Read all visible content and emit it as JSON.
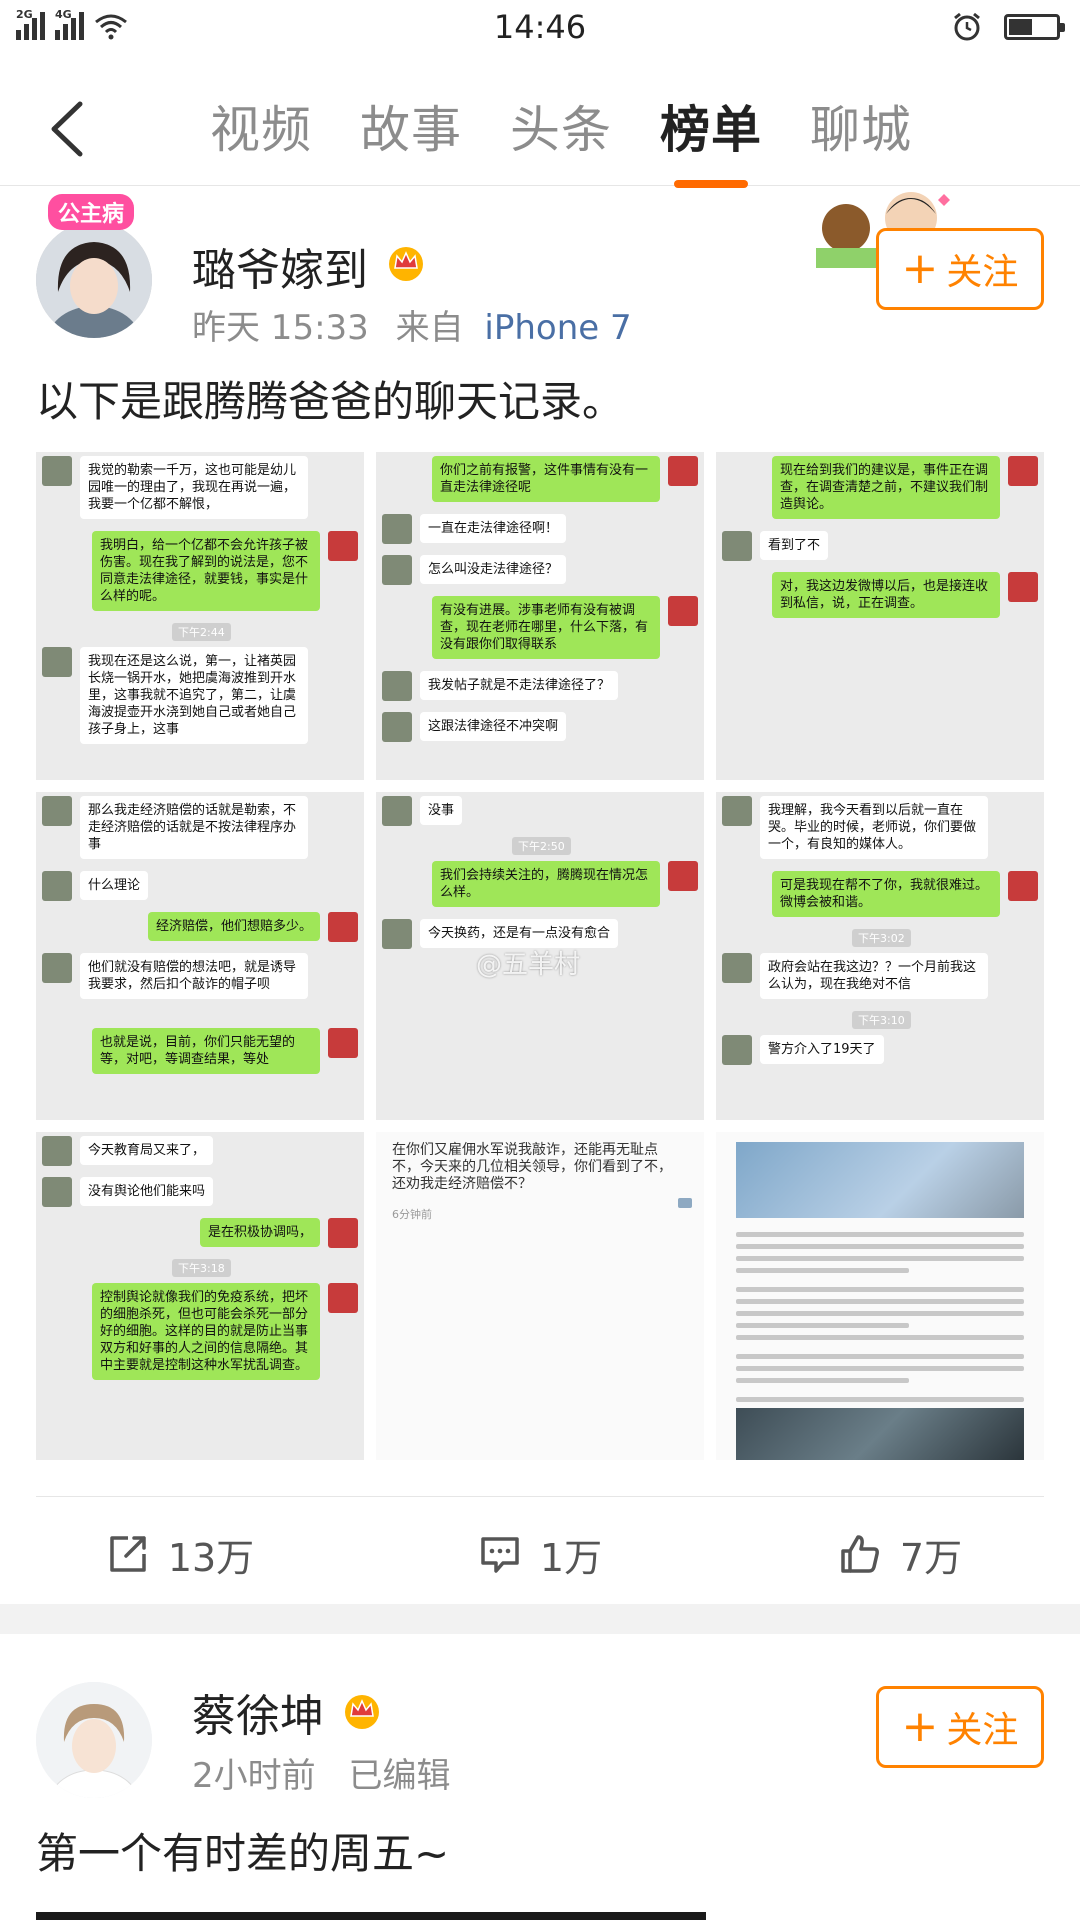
{
  "status_bar": {
    "network_1": "2G",
    "network_2": "4G",
    "time": "14:46",
    "battery_level": 0.5
  },
  "nav": {
    "tabs": [
      {
        "label": "视频"
      },
      {
        "label": "故事"
      },
      {
        "label": "头条"
      },
      {
        "label": "榜单",
        "active": true
      },
      {
        "label": "聊城"
      }
    ]
  },
  "post1": {
    "username": "璐爷嫁到",
    "avatar_badge": "公主病",
    "time": "昨天 15:33",
    "source_prefix": "来自",
    "source": "iPhone 7",
    "follow_label": "关注",
    "text": "以下是跟腾腾爸爸的聊天记录。",
    "images": [
      {
        "bubbles": [
          {
            "side": "l",
            "text": "我觉的勒索一千万，这也可能是幼儿园唯一的理由了，我现在再说一遍，我要一个亿都不解恨，"
          },
          {
            "side": "r",
            "text": "我明白，给一个亿都不会允许孩子被伤害。现在我了解到的说法是，您不同意走法律途径，就要钱，事实是什么样的呢。"
          },
          {
            "side": "ts",
            "text": "下午2:44"
          },
          {
            "side": "l",
            "text": "我现在还是这么说，第一，让褚英园长烧一锅开水，她把虞海波推到开水里，这事我就不追究了，第二，让虞海波提壶开水浇到她自己或者她自己孩子身上，这事"
          }
        ]
      },
      {
        "bubbles": [
          {
            "side": "r",
            "text": "你们之前有报警，这件事情有没有一直走法律途径呢"
          },
          {
            "side": "l",
            "text": "一直在走法律途径啊！"
          },
          {
            "side": "l",
            "text": "怎么叫没走法律途径？"
          },
          {
            "side": "r",
            "text": "有没有进展。涉事老师有没有被调查，现在老师在哪里，什么下落，有没有跟你们取得联系"
          },
          {
            "side": "l",
            "text": "我发帖子就是不走法律途径了？"
          },
          {
            "side": "l",
            "text": "这跟法律途径不冲突啊"
          }
        ]
      },
      {
        "bubbles": [
          {
            "side": "r",
            "text": "现在给到我们的建议是，事件正在调查，在调查清楚之前，不建议我们制造舆论。"
          },
          {
            "side": "l",
            "text": "看到了不"
          },
          {
            "side": "r",
            "text": "对，我这边发微博以后，也是接连收到私信，说，正在调查。"
          }
        ]
      },
      {
        "bubbles": [
          {
            "side": "l",
            "text": "那么我走经济赔偿的话就是勒索，不走经济赔偿的话就是不按法律程序办事"
          },
          {
            "side": "l",
            "text": "什么理论"
          },
          {
            "side": "r",
            "text": "经济赔偿，他们想赔多少。"
          },
          {
            "side": "l",
            "text": "他们就没有赔偿的想法吧，就是诱导我要求，然后扣个敲诈的帽子呗"
          },
          {
            "side": "r",
            "text": "也就是说，目前，你们只能无望的等，对吧，等调查结果，等处"
          }
        ]
      },
      {
        "bubbles": [
          {
            "side": "l",
            "text": "没事"
          },
          {
            "side": "ts",
            "text": "下午2:50"
          },
          {
            "side": "r",
            "text": "我们会持续关注的，腾腾现在情况怎么样。"
          },
          {
            "side": "l",
            "text": "今天换药，还是有一点没有愈合"
          }
        ]
      },
      {
        "bubbles": [
          {
            "side": "l",
            "text": "我理解，我今天看到以后就一直在哭。毕业的时候，老师说，你们要做一个，有良知的媒体人。"
          },
          {
            "side": "r",
            "text": "可是我现在帮不了你，我就很难过。微博会被和谐。"
          },
          {
            "side": "ts",
            "text": "下午3:02"
          },
          {
            "side": "l",
            "text": "政府会站在我这边？？一个月前我这么认为，现在我绝对不信"
          },
          {
            "side": "ts",
            "text": "下午3:10"
          },
          {
            "side": "l",
            "text": "警方介入了19天了"
          }
        ]
      },
      {
        "bubbles": [
          {
            "side": "l",
            "text": "今天教育局又来了，"
          },
          {
            "side": "l",
            "text": "没有舆论他们能来吗"
          },
          {
            "side": "r",
            "text": "是在积极协调吗，"
          },
          {
            "side": "ts",
            "text": "下午3:18"
          },
          {
            "side": "r",
            "text": "控制舆论就像我们的免疫系统，把坏的细胞杀死，但也可能会杀死一部分好的细胞。这样的目的就是防止当事双方和好事的人之间的信息隔绝。其中主要就是控制这种水军扰乱调查。"
          }
        ]
      },
      {
        "bubbles": [
          {
            "side": "doc",
            "text": "在你们又雇佣水军说我敲诈，还能再无耻点不，今天来的几位相关领导，你们看到了不，还劝我走经济赔偿不？"
          },
          {
            "side": "doc_time",
            "text": "6分钟前"
          }
        ]
      },
      {
        "bubbles": []
      }
    ],
    "watermark": "@五羊村",
    "actions": {
      "repost_count": "13万",
      "comment_count": "1万",
      "like_count": "7万"
    }
  },
  "post2": {
    "username": "蔡徐坤",
    "time": "2小时前",
    "edited": "已编辑",
    "follow_label": "关注",
    "text": "第一个有时差的周五~"
  },
  "colors": {
    "accent": "#ff8200",
    "tab_indicator": "#ff6a00",
    "link": "#4a6fa5",
    "wechat_green": "#9fe658"
  }
}
